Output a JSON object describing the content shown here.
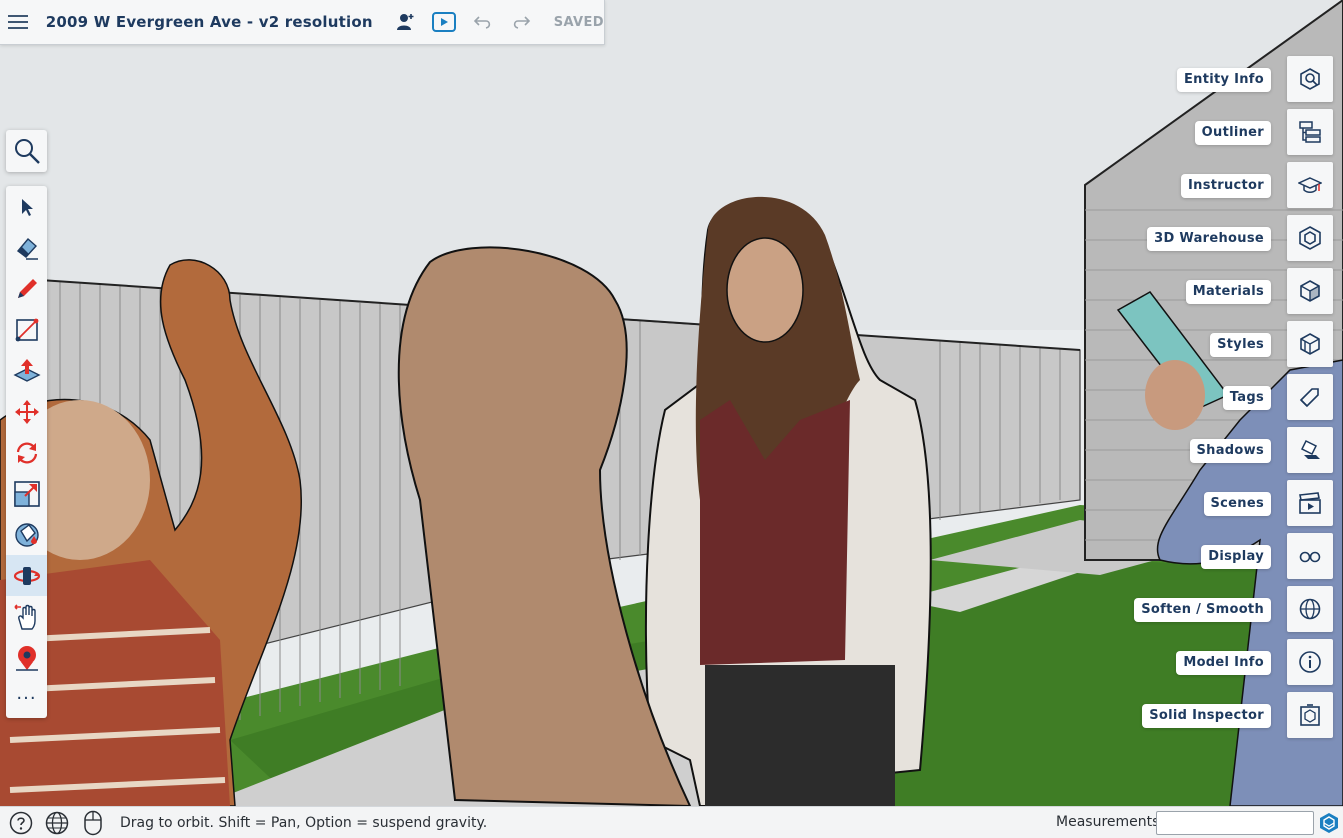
{
  "top_bar": {
    "menu_icon": "hamburger-menu-icon",
    "title": "2009 W Evergreen Ave - v2 resolution",
    "collaborate_icon": "add-person-icon",
    "present_icon": "play-presentation-icon",
    "undo_icon": "undo-icon",
    "redo_icon": "redo-icon",
    "status": "SAVED"
  },
  "left_toolbar": {
    "search_icon": "search-icon",
    "tools": [
      {
        "name": "select",
        "icon": "arrow-select-icon"
      },
      {
        "name": "eraser",
        "icon": "eraser-icon"
      },
      {
        "name": "pencil",
        "icon": "pencil-icon"
      },
      {
        "name": "rectangle",
        "icon": "rectangle-icon"
      },
      {
        "name": "push-pull",
        "icon": "push-pull-icon"
      },
      {
        "name": "move",
        "icon": "move-arrows-icon"
      },
      {
        "name": "rotate",
        "icon": "rotate-icon"
      },
      {
        "name": "scale",
        "icon": "scale-icon"
      },
      {
        "name": "paint-bucket",
        "icon": "paint-bucket-icon"
      },
      {
        "name": "orbit",
        "icon": "orbit-icon",
        "active": true
      },
      {
        "name": "pan",
        "icon": "pan-hand-icon"
      },
      {
        "name": "position-camera",
        "icon": "position-camera-icon"
      },
      {
        "name": "more",
        "icon": "more-dots-icon"
      }
    ],
    "more_label": "···"
  },
  "right_panel": {
    "items": [
      {
        "label": "Entity Info",
        "icon": "entity-info-icon"
      },
      {
        "label": "Outliner",
        "icon": "outliner-icon"
      },
      {
        "label": "Instructor",
        "icon": "graduation-cap-icon"
      },
      {
        "label": "3D Warehouse",
        "icon": "warehouse-icon"
      },
      {
        "label": "Materials",
        "icon": "materials-cube-icon"
      },
      {
        "label": "Styles",
        "icon": "styles-icon"
      },
      {
        "label": "Tags",
        "icon": "tag-icon"
      },
      {
        "label": "Shadows",
        "icon": "shadow-icon"
      },
      {
        "label": "Scenes",
        "icon": "clapperboard-icon"
      },
      {
        "label": "Display",
        "icon": "glasses-icon"
      },
      {
        "label": "Soften / Smooth",
        "icon": "sphere-icon"
      },
      {
        "label": "Model Info",
        "icon": "info-icon"
      },
      {
        "label": "Solid Inspector",
        "icon": "solid-inspector-icon"
      }
    ]
  },
  "status_bar": {
    "help_icon": "help-icon",
    "geo_icon": "globe-icon",
    "mouse_icon": "mouse-icon",
    "hint": "Drag to orbit. Shift = Pan, Option = suspend gravity.",
    "measurements_label": "Measurements",
    "measurements_value": "",
    "logo_icon": "sketchup-logo-icon"
  },
  "colors": {
    "accent": "#1e3a5f",
    "tool_red": "#e0302a",
    "active_tool_bg": "#d7e6f3",
    "saved_gray": "#9aa3ab"
  }
}
